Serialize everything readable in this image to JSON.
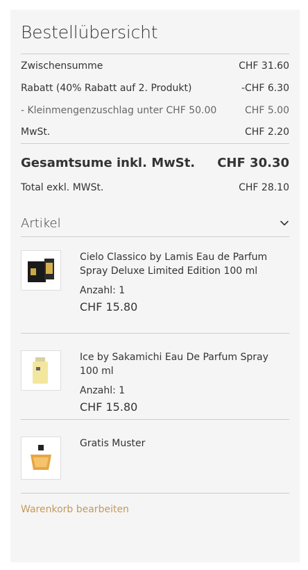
{
  "summary": {
    "title": "Bestellübersicht",
    "rows": [
      {
        "label": "Zwischensumme",
        "value": "CHF 31.60"
      },
      {
        "label": "Rabatt (40% Rabatt auf 2. Produkt)",
        "value": "-CHF 6.30"
      },
      {
        "label": "- Kleinmengenzuschlag unter CHF 50.00",
        "value": "CHF 5.00"
      },
      {
        "label": "MwSt.",
        "value": "CHF 2.20"
      }
    ],
    "grand_total": {
      "label": "Gesamtsume inkl. MwSt.",
      "value": "CHF 30.30"
    },
    "excl_total": {
      "label": "Total exkl. MWSt.",
      "value": "CHF 28.10"
    }
  },
  "items_section": {
    "label": "Artikel",
    "items": [
      {
        "name": "Cielo Classico by Lamis Eau de Parfum Spray Deluxe Limited Edition 100 ml",
        "qty": "Anzahl: 1",
        "price": "CHF 15.80"
      },
      {
        "name": "Ice by Sakamichi Eau De Parfum Spray 100 ml",
        "qty": "Anzahl: 1",
        "price": "CHF 15.80"
      },
      {
        "name": "Gratis Muster"
      }
    ]
  },
  "edit_cart_label": "Warenkorb bearbeiten",
  "colors": {
    "panel_bg": "#f5f5f5",
    "divider": "#cccccc",
    "link": "#c49a5c"
  }
}
